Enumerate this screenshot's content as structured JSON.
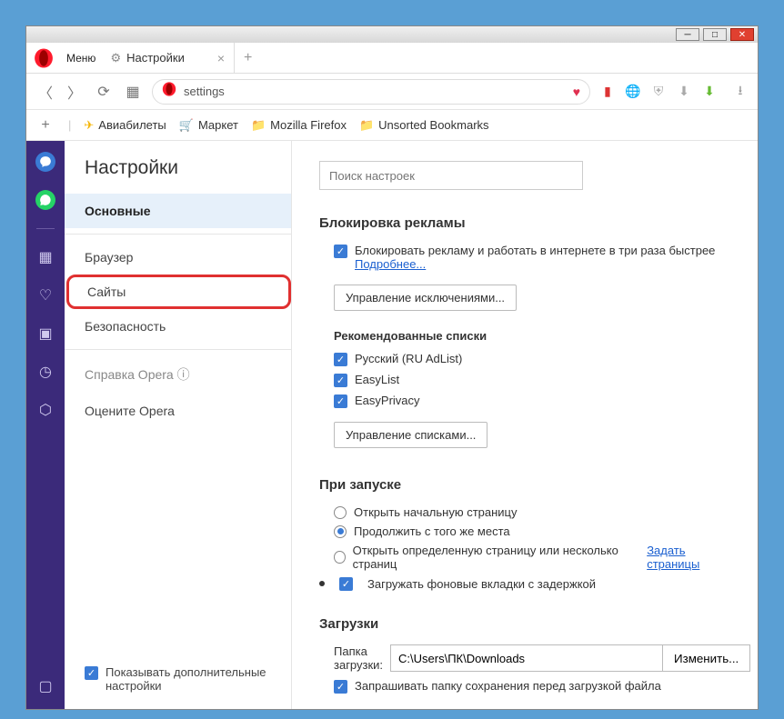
{
  "window": {
    "menu_label": "Меню",
    "tab_title": "Настройки",
    "address": "settings"
  },
  "bookmarks": {
    "avia": "Авиабилеты",
    "market": "Маркет",
    "mozilla": "Mozilla Firefox",
    "unsorted": "Unsorted Bookmarks"
  },
  "sidebar": {
    "title": "Настройки",
    "items": {
      "basic": "Основные",
      "browser": "Браузер",
      "sites": "Сайты",
      "security": "Безопасность",
      "help": "Справка Opera",
      "rate": "Оцените Opera"
    },
    "adv_label": "Показывать дополнительные настройки"
  },
  "search": {
    "placeholder": "Поиск настроек"
  },
  "adblock": {
    "heading": "Блокировка рекламы",
    "block_label": "Блокировать рекламу и работать в интернете в три раза быстрее",
    "more_link": "Подробнее...",
    "manage_exceptions": "Управление исключениями...",
    "rec_heading": "Рекомендованные списки",
    "list_ru": "Русский (RU AdList)",
    "list_easy": "EasyList",
    "list_privacy": "EasyPrivacy",
    "manage_lists": "Управление списками..."
  },
  "startup": {
    "heading": "При запуске",
    "opt_home": "Открыть начальную страницу",
    "opt_continue": "Продолжить с того же места",
    "opt_specific": "Открыть определенную страницу или несколько страниц",
    "set_pages_link": "Задать страницы",
    "lazy_load": "Загружать фоновые вкладки с задержкой"
  },
  "downloads": {
    "heading": "Загрузки",
    "folder_label": "Папка загрузки:",
    "folder_value": "C:\\Users\\ПК\\Downloads",
    "change_btn": "Изменить...",
    "ask_label": "Запрашивать папку сохранения перед загрузкой файла"
  }
}
